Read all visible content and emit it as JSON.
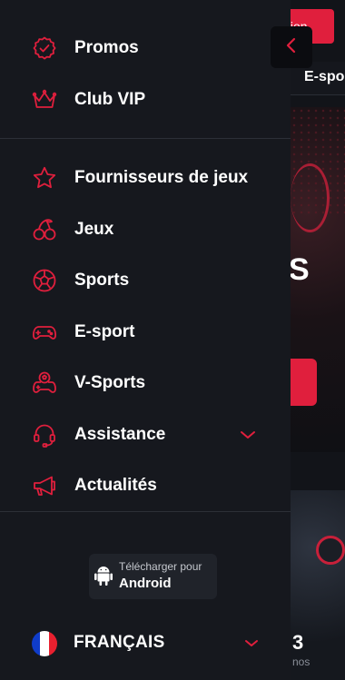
{
  "background": {
    "top_button_label": "tion",
    "tab_label": "E-spor",
    "hero_letter": "S",
    "card_title": "3",
    "card_subtitle": "nos"
  },
  "menu": {
    "top_items": [
      {
        "label": "Promos",
        "icon": "badge-percent-icon"
      },
      {
        "label": "Club VIP",
        "icon": "crown-icon"
      }
    ],
    "items": [
      {
        "label": "Fournisseurs de jeux",
        "icon": "star-icon"
      },
      {
        "label": "Jeux",
        "icon": "cherries-icon"
      },
      {
        "label": "Sports",
        "icon": "soccer-ball-icon"
      },
      {
        "label": "E-sport",
        "icon": "gamepad-icon"
      },
      {
        "label": "V-Sports",
        "icon": "gamepad-ball-icon"
      },
      {
        "label": "Assistance",
        "icon": "headset-icon"
      },
      {
        "label": "Actualités",
        "icon": "megaphone-icon"
      }
    ]
  },
  "download": {
    "small_label": "Télécharger pour",
    "platform": "Android"
  },
  "language": {
    "label": "FRANÇAIS"
  },
  "colors": {
    "accent": "#e01f3d",
    "drawer_bg": "#16181e",
    "text": "#ffffff"
  }
}
